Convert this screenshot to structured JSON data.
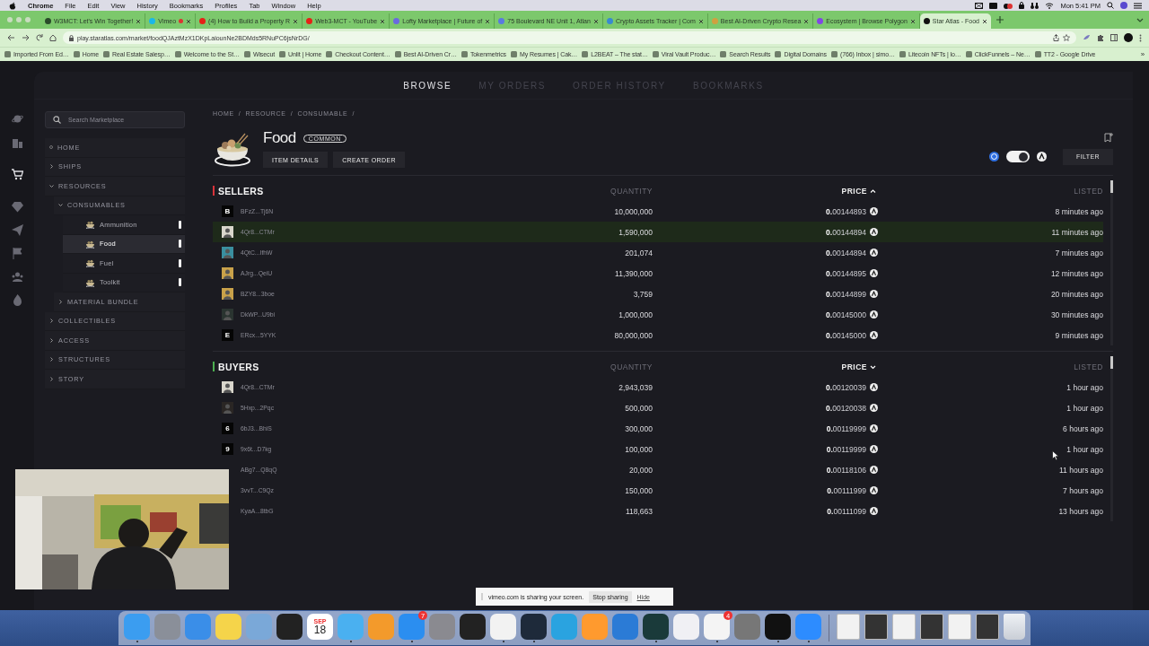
{
  "menu_bar": {
    "app": "Chrome",
    "menus": [
      "File",
      "Edit",
      "View",
      "History",
      "Bookmarks",
      "Profiles",
      "Tab",
      "Window",
      "Help"
    ],
    "clock": "Mon 5:41 PM"
  },
  "browser": {
    "tabs": [
      {
        "title": "W3MCT: Let's Win Together!",
        "color": "#2a4a2a",
        "selected": false,
        "recording": false
      },
      {
        "title": "Vimeo",
        "color": "#1ab7ea",
        "selected": false,
        "recording": true
      },
      {
        "title": "(4) How to Build a Property R",
        "color": "#e62117",
        "selected": false,
        "recording": false
      },
      {
        "title": "Web3-MCT - YouTube",
        "color": "#e62117",
        "selected": false,
        "recording": false
      },
      {
        "title": "Lofty Marketplace | Future of",
        "color": "#6a6ae0",
        "selected": false,
        "recording": false
      },
      {
        "title": "75 Boulevard NE Unit 1, Atlan",
        "color": "#5a7ae0",
        "selected": false,
        "recording": false
      },
      {
        "title": "Crypto Assets Tracker | Com",
        "color": "#3a8ad0",
        "selected": false,
        "recording": false
      },
      {
        "title": "Best AI-Driven Crypto Resea",
        "color": "#d0a040",
        "selected": false,
        "recording": false
      },
      {
        "title": "Ecosystem | Browse Polygon",
        "color": "#8247e5",
        "selected": false,
        "recording": false
      },
      {
        "title": "Star Atlas - Food",
        "color": "#111111",
        "selected": true,
        "recording": false
      }
    ],
    "url": "play.staratlas.com/market/foodQJAztMzX1DKpLaiounNe2BDMds5RNuPC6jsNrDG/",
    "bookmarks": [
      "Imported From Ed…",
      "Home",
      "Real Estate Salesp…",
      "Welcome to the St…",
      "Wisecut",
      "Unlit | Home",
      "Checkout Content…",
      "Best AI-Driven Cr…",
      "Tokenmetrics",
      "My Resumes | Cak…",
      "L2BEAT – The stat…",
      "Viral Vault Produc…",
      "Search Results",
      "Digital Domains",
      "(766) Inbox | simo…",
      "Litecoin NFTs | lo…",
      "ClickFunnels – Ne…",
      "TT2 - Google Drive"
    ],
    "bookmarks_more": "»"
  },
  "market": {
    "rail": [
      {
        "selected": false
      },
      {
        "selected": false
      },
      {
        "selected": true
      },
      {
        "selected": false
      },
      {
        "selected": false
      },
      {
        "selected": false
      },
      {
        "selected": false
      },
      {
        "selected": false
      }
    ],
    "nav_tabs": [
      {
        "label": "BROWSE",
        "selected": true
      },
      {
        "label": "MY ORDERS",
        "selected": false
      },
      {
        "label": "ORDER HISTORY",
        "selected": false
      },
      {
        "label": "BOOKMARKS",
        "selected": false
      }
    ],
    "sidebar": {
      "search": {
        "placeholder": "Search Marketplace"
      },
      "items": [
        {
          "kind": "link",
          "label": "HOME"
        },
        {
          "kind": "group",
          "label": "SHIPS",
          "expanded": false
        },
        {
          "kind": "group",
          "label": "RESOURCES",
          "expanded": true,
          "children": [
            {
              "kind": "group",
              "label": "CONSUMABLES",
              "expanded": true,
              "children": [
                {
                  "kind": "item",
                  "label": "Ammunition",
                  "selected": false
                },
                {
                  "kind": "item",
                  "label": "Food",
                  "selected": true
                },
                {
                  "kind": "item",
                  "label": "Fuel",
                  "selected": false
                },
                {
                  "kind": "item",
                  "label": "Toolkit",
                  "selected": false
                }
              ]
            },
            {
              "kind": "group",
              "label": "MATERIAL BUNDLE",
              "expanded": false
            }
          ]
        },
        {
          "kind": "group",
          "label": "COLLECTIBLES",
          "expanded": false
        },
        {
          "kind": "group",
          "label": "ACCESS",
          "expanded": false
        },
        {
          "kind": "group",
          "label": "STRUCTURES",
          "expanded": false
        },
        {
          "kind": "group",
          "label": "STORY",
          "expanded": false
        }
      ]
    },
    "breadcrumb": {
      "items": [
        "HOME",
        "RESOURCE",
        "CONSUMABLE"
      ],
      "separator": "/"
    },
    "product": {
      "name": "Food",
      "rarity": "COMMON",
      "buttons": [
        "ITEM DETAILS",
        "CREATE ORDER"
      ],
      "currency_toggle": {
        "on": true
      },
      "filter": "FILTER"
    },
    "books": [
      {
        "title": "SELLERS",
        "color": "#d8333a",
        "columns": {
          "quantity": "QUANTITY",
          "price": "PRICE",
          "listed": "LISTED"
        },
        "sort_ascending": true,
        "rows": [
          {
            "avatar": {
              "kind": "letter",
              "letter": "B"
            },
            "address": "BFzZ...Tj6N",
            "quantity": "10,000,000",
            "price": "**0.**00144893",
            "listed": "8 minutes ago",
            "highlighted": false
          },
          {
            "address": "4Qr8...CTMr",
            "quantity": "1,590,000",
            "price": "**0.**00144894",
            "listed": "11 minutes ago",
            "highlighted": true
          },
          {
            "address": "4QtC...IfhW",
            "quantity": "201,074",
            "price": "**0.**00144894",
            "listed": "7 minutes ago",
            "highlighted": false
          },
          {
            "address": "AJrg...QeiU",
            "quantity": "11,390,000",
            "price": "**0.**00144895",
            "listed": "12 minutes ago",
            "highlighted": false
          },
          {
            "address": "BZY8...3boe",
            "quantity": "3,759",
            "price": "**0.**00144899",
            "listed": "20 minutes ago",
            "highlighted": false
          },
          {
            "address": "DkWP...U9bi",
            "quantity": "1,000,000",
            "price": "**0.**00145000",
            "listed": "30 minutes ago",
            "highlighted": false
          },
          {
            "avatar": {
              "kind": "letter",
              "letter": "E"
            },
            "address": "ERcx...5YYK",
            "quantity": "80,000,000",
            "price": "**0.**00145000",
            "listed": "9 minutes ago",
            "highlighted": false
          }
        ]
      },
      {
        "title": "BUYERS",
        "color": "#4caf50",
        "columns": {
          "quantity": "QUANTITY",
          "price": "PRICE",
          "listed": "LISTED"
        },
        "sort_ascending": false,
        "rows": [
          {
            "address": "4Qr8...CTMr",
            "quantity": "2,943,039",
            "price": "**0.**00120039",
            "listed": "1 hour ago",
            "highlighted": false
          },
          {
            "address": "5Hxp...2Pqc",
            "quantity": "500,000",
            "price": "**0.**00120038",
            "listed": "1 hour ago",
            "highlighted": false
          },
          {
            "avatar": {
              "kind": "letter",
              "letter": "6"
            },
            "address": "6bJ3...BhiS",
            "quantity": "300,000",
            "price": "**0.**00119999",
            "listed": "6 hours ago",
            "highlighted": false
          },
          {
            "avatar": {
              "kind": "letter",
              "letter": "9"
            },
            "address": "9x6t...D7kg",
            "quantity": "100,000",
            "price": "**0.**00119999",
            "listed": "1 hour ago",
            "highlighted": false
          },
          {
            "avatar": {
              "kind": "hidden"
            },
            "address": "ABg7...Q8qQ",
            "quantity": "20,000",
            "price": "**0.**00118106",
            "listed": "11 hours ago",
            "highlighted": false
          },
          {
            "avatar": {
              "kind": "hidden"
            },
            "address": "3vvT...C9Qz",
            "quantity": "150,000",
            "price": "**0.**00111999",
            "listed": "7 hours ago",
            "highlighted": false
          },
          {
            "avatar": {
              "kind": "hidden"
            },
            "address": "KyaA...8tbG",
            "quantity": "118,663",
            "price": "**0.**00111099",
            "listed": "13 hours ago",
            "highlighted": false
          }
        ]
      }
    ]
  },
  "sharing_notice": {
    "message": "vimeo.com is sharing your screen.",
    "buttons": [
      "Stop sharing",
      "Hide"
    ]
  },
  "dock": {
    "items": [
      {
        "kind": "app",
        "running": true
      },
      {
        "kind": "app",
        "running": false
      },
      {
        "kind": "app",
        "running": false
      },
      {
        "kind": "app",
        "running": false
      },
      {
        "kind": "app",
        "running": false
      },
      {
        "kind": "app",
        "running": false
      },
      {
        "kind": "calendar",
        "month": "SEP",
        "day": "18",
        "running": false
      },
      {
        "kind": "app",
        "running": true
      },
      {
        "kind": "app",
        "running": false
      },
      {
        "kind": "app",
        "running": true,
        "badge": "7"
      },
      {
        "kind": "app",
        "running": false
      },
      {
        "kind": "app",
        "running": false
      },
      {
        "kind": "app",
        "running": true
      },
      {
        "kind": "app",
        "running": true
      },
      {
        "kind": "app",
        "running": false
      },
      {
        "kind": "app",
        "running": false
      },
      {
        "kind": "app",
        "running": false
      },
      {
        "kind": "app",
        "running": true
      },
      {
        "kind": "app",
        "running": false
      },
      {
        "kind": "app",
        "running": true,
        "badge": "4"
      },
      {
        "kind": "app",
        "running": false
      },
      {
        "kind": "app",
        "running": true
      },
      {
        "kind": "app",
        "running": true
      },
      {
        "kind": "separator"
      },
      {
        "kind": "document"
      },
      {
        "kind": "document"
      },
      {
        "kind": "document"
      },
      {
        "kind": "document"
      },
      {
        "kind": "document"
      },
      {
        "kind": "document"
      },
      {
        "kind": "trash"
      }
    ]
  }
}
